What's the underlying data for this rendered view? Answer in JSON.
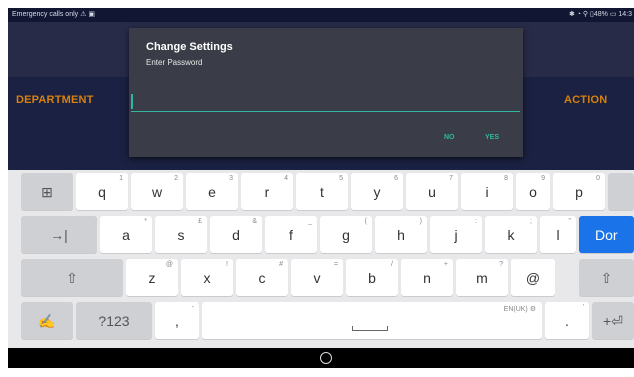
{
  "status_bar": {
    "left_text": "Emergency calls only",
    "left_icons": "⚠ ▣",
    "right_text": "✱ ◔ ⚲ ▯48% ▭ 14:3"
  },
  "table_headers": {
    "department": "DEPARTMENT",
    "action": "ACTION"
  },
  "dialog": {
    "title": "Change Settings",
    "message": "Enter Password",
    "password_value": "",
    "no_label": "NO",
    "yes_label": "YES"
  },
  "keyboard": {
    "row1": [
      {
        "label": "q",
        "hint": "1"
      },
      {
        "label": "w",
        "hint": "2"
      },
      {
        "label": "e",
        "hint": "3"
      },
      {
        "label": "r",
        "hint": "4"
      },
      {
        "label": "t",
        "hint": "5"
      },
      {
        "label": "y",
        "hint": "6"
      },
      {
        "label": "u",
        "hint": "7"
      },
      {
        "label": "i",
        "hint": "8"
      },
      {
        "label": "o",
        "hint": "9"
      },
      {
        "label": "p",
        "hint": "0"
      }
    ],
    "row2": [
      {
        "label": "a",
        "hint": "*"
      },
      {
        "label": "s",
        "hint": "£"
      },
      {
        "label": "d",
        "hint": "&"
      },
      {
        "label": "f",
        "hint": "_"
      },
      {
        "label": "g",
        "hint": "("
      },
      {
        "label": "h",
        "hint": ")"
      },
      {
        "label": "j",
        "hint": ":"
      },
      {
        "label": "k",
        "hint": ";"
      },
      {
        "label": "l",
        "hint": "\""
      }
    ],
    "row3": [
      {
        "label": "z",
        "hint": "@"
      },
      {
        "label": "x",
        "hint": "!"
      },
      {
        "label": "c",
        "hint": "#"
      },
      {
        "label": "v",
        "hint": "="
      },
      {
        "label": "b",
        "hint": "/"
      },
      {
        "label": "n",
        "hint": "+"
      },
      {
        "label": "m",
        "hint": "?"
      },
      {
        "label": "@",
        "hint": ""
      }
    ],
    "emoji_key": "⊞",
    "tab_key": "→|",
    "shift_key": "⇧",
    "done_label": "Dor",
    "handwrite_key": "✍",
    "symbols_label": "?123",
    "comma_label": ",",
    "comma_hint": "-",
    "space_lang": "EN(UK) ⚙",
    "period_label": ".",
    "period_hint": "'",
    "enter_key": "+⏎"
  }
}
